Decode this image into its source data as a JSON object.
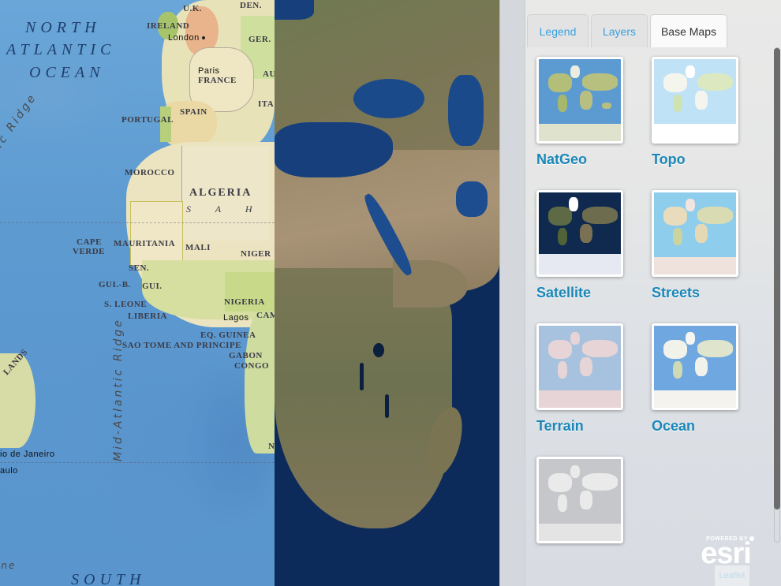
{
  "map": {
    "natgeo_labels": {
      "oceans": [
        "NORTH",
        "ATLANTIC",
        "OCEAN",
        "SOUTH"
      ],
      "features": [
        "Mid-Atlantic Ridge",
        "tic Ridge",
        "ine"
      ],
      "regions": [
        "S A H A"
      ],
      "countries": [
        "U.K.",
        "DEN.",
        "IRELAND",
        "GER.",
        "FRANCE",
        "AU",
        "ITA",
        "PORTUGAL",
        "SPAIN",
        "MOROCCO",
        "ALGERIA",
        "CAPE",
        "VERDE",
        "MAURITANIA",
        "MALI",
        "NIGER",
        "SEN.",
        "GUI.-B.",
        "GUI.",
        "S. LEONE",
        "LIBERIA",
        "NIGERIA",
        "CAM",
        "EQ. GUINEA",
        "SAO TOME AND PRINCIPE",
        "GABON",
        "CONGO",
        "LANDS",
        "N"
      ],
      "cities": [
        "London",
        "Paris",
        "Lagos",
        "io de Janeiro",
        "aulo"
      ]
    }
  },
  "panel": {
    "tabs": [
      {
        "label": "Legend",
        "active": false
      },
      {
        "label": "Layers",
        "active": false
      },
      {
        "label": "Base Maps",
        "active": true
      }
    ],
    "basemaps": [
      {
        "label": "NatGeo"
      },
      {
        "label": "Topo"
      },
      {
        "label": "Satellite"
      },
      {
        "label": "Streets"
      },
      {
        "label": "Terrain"
      },
      {
        "label": "Ocean"
      },
      {
        "label": ""
      }
    ]
  },
  "attribution": {
    "powered_by": "POWERED BY",
    "brand": "esri",
    "leaflet": "Leaflet"
  },
  "colors": {
    "tab_link": "#39a0e0",
    "basemap_label": "#1a87b8"
  }
}
